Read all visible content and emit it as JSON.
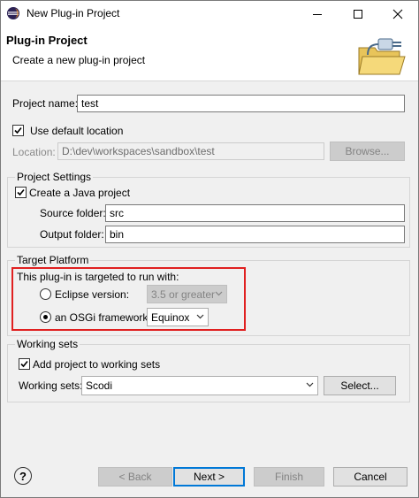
{
  "window": {
    "title": "New Plug-in Project"
  },
  "header": {
    "title": "Plug-in Project",
    "subtitle": "Create a new plug-in project"
  },
  "project_name": {
    "label": "Project name:",
    "value": "test"
  },
  "default_location": {
    "label": "Use default location",
    "checked": true
  },
  "location": {
    "label": "Location:",
    "value": "D:\\dev\\workspaces\\sandbox\\test",
    "browse_label": "Browse..."
  },
  "project_settings": {
    "title": "Project Settings",
    "java_project": {
      "label": "Create a Java project",
      "checked": true
    },
    "source_folder": {
      "label": "Source folder:",
      "value": "src"
    },
    "output_folder": {
      "label": "Output folder:",
      "value": "bin"
    }
  },
  "target_platform": {
    "title": "Target Platform",
    "intro": "This plug-in is targeted to run with:",
    "eclipse": {
      "label": "Eclipse version:",
      "selected": false,
      "value": "3.5 or greater"
    },
    "osgi": {
      "label": "an OSGi framework:",
      "selected": true,
      "value": "Equinox"
    }
  },
  "working_sets": {
    "title": "Working sets",
    "add": {
      "label": "Add project to working sets",
      "checked": true
    },
    "sets": {
      "label": "Working sets:",
      "value": "Scodi"
    },
    "select_label": "Select..."
  },
  "footer": {
    "help": "?",
    "back": "< Back",
    "next": "Next >",
    "finish": "Finish",
    "cancel": "Cancel"
  },
  "colors": {
    "highlight_border": "#e02020",
    "default_button": "#0078d7"
  }
}
